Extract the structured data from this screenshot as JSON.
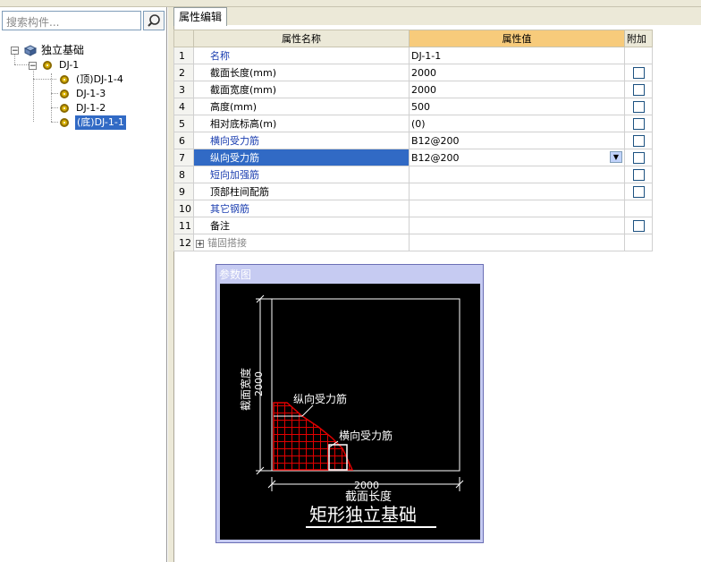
{
  "left_panel": {
    "search_placeholder": "搜索构件...",
    "tree": {
      "root": "独立基础",
      "group": "DJ-1",
      "children": [
        "(顶)DJ-1-4",
        "DJ-1-3",
        "DJ-1-2",
        "(底)DJ-1-1"
      ],
      "selected": "(底)DJ-1-1"
    }
  },
  "tab": {
    "label": "属性编辑"
  },
  "grid": {
    "headers": {
      "name": "属性名称",
      "value": "属性值",
      "attach": "附加"
    },
    "rows": [
      {
        "num": "1",
        "name": "名称",
        "value": "DJ-1-1",
        "name_color": "blue",
        "checkbox": false
      },
      {
        "num": "2",
        "name": "截面长度(mm)",
        "value": "2000",
        "name_color": "black",
        "checkbox": true
      },
      {
        "num": "3",
        "name": "截面宽度(mm)",
        "value": "2000",
        "name_color": "black",
        "checkbox": true
      },
      {
        "num": "4",
        "name": "高度(mm)",
        "value": "500",
        "name_color": "black",
        "checkbox": true
      },
      {
        "num": "5",
        "name": "相对底标高(m)",
        "value": "(0)",
        "name_color": "black",
        "checkbox": true
      },
      {
        "num": "6",
        "name": "横向受力筋",
        "value": "B12@200",
        "name_color": "blue",
        "checkbox": true
      },
      {
        "num": "7",
        "name": "纵向受力筋",
        "value": "B12@200",
        "name_color": "selected",
        "checkbox": true
      },
      {
        "num": "8",
        "name": "短向加强筋",
        "value": "",
        "name_color": "blue",
        "checkbox": true
      },
      {
        "num": "9",
        "name": "顶部柱间配筋",
        "value": "",
        "name_color": "black",
        "checkbox": true
      },
      {
        "num": "10",
        "name": "其它钢筋",
        "value": "",
        "name_color": "blue",
        "checkbox": false
      },
      {
        "num": "11",
        "name": "备注",
        "value": "",
        "name_color": "black",
        "checkbox": true
      },
      {
        "num": "12",
        "name": "锚固搭接",
        "value": "",
        "name_color": "gray",
        "checkbox": false
      }
    ]
  },
  "param_dialog": {
    "title": "参数图",
    "labels": {
      "width_label": "截面宽度",
      "width_value": "2000",
      "length_value": "2000",
      "length_label": "截面长度",
      "long_bar": "纵向受力筋",
      "trans_bar": "横向受力筋",
      "caption": "矩形独立基础"
    },
    "colors": {
      "rebar": "#e00000",
      "outline": "#ffffff",
      "background": "#000000"
    }
  }
}
